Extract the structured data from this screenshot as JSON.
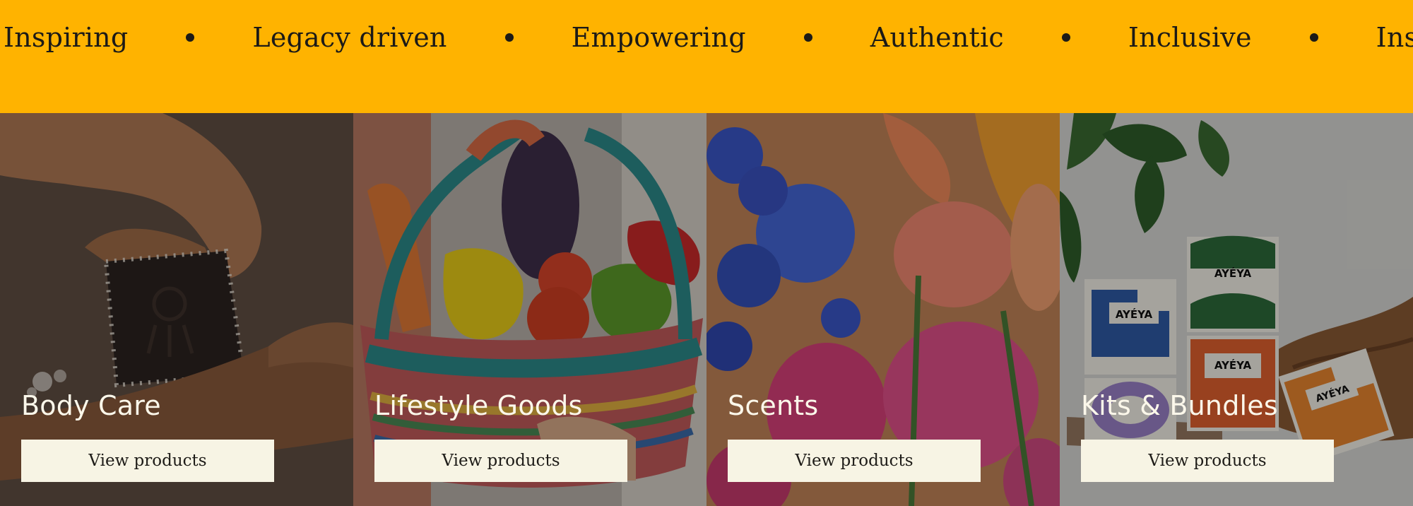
{
  "marquee": {
    "words": [
      "Inspiring",
      "Legacy driven",
      "Empowering",
      "Authentic",
      "Inclusive",
      "Inspiring"
    ],
    "background": "#FFB300"
  },
  "collections": [
    {
      "title": "Body Care",
      "button_label": "View products"
    },
    {
      "title": "Lifestyle Goods",
      "button_label": "View products"
    },
    {
      "title": "Scents",
      "button_label": "View products"
    },
    {
      "title": "Kits & Bundles",
      "button_label": "View products"
    }
  ],
  "product_brand": "AYÉYA"
}
